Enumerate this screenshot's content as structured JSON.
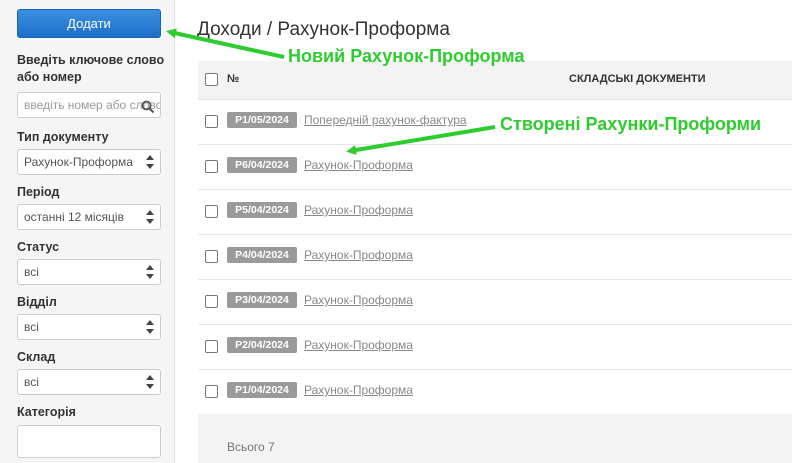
{
  "sidebar": {
    "add_button": "Додати",
    "keyword_label": "Введіть ключове слово або номер",
    "search_placeholder": "введіть номер або слово",
    "doc_type_label": "Тип документу",
    "doc_type_value": "Рахунок-Проформа",
    "period_label": "Період",
    "period_value": "останні 12 місяців",
    "status_label": "Статус",
    "status_value": "всі",
    "department_label": "Відділ",
    "department_value": "всі",
    "warehouse_label": "Склад",
    "warehouse_value": "всі",
    "category_label": "Категорія",
    "category_value": ""
  },
  "page_title": "Доходи / Рахунок-Проформа",
  "table": {
    "col_number": "№",
    "col_docs": "СКЛАДСЬКІ ДОКУМЕНТИ",
    "rows": [
      {
        "number": "P1/05/2024",
        "type": "Попередній рахунок-фактура"
      },
      {
        "number": "P6/04/2024",
        "type": "Рахунок-Проформа"
      },
      {
        "number": "P5/04/2024",
        "type": "Рахунок-Проформа"
      },
      {
        "number": "P4/04/2024",
        "type": "Рахунок-Проформа"
      },
      {
        "number": "P3/04/2024",
        "type": "Рахунок-Проформа"
      },
      {
        "number": "P2/04/2024",
        "type": "Рахунок-Проформа"
      },
      {
        "number": "P1/04/2024",
        "type": "Рахунок-Проформа"
      }
    ],
    "total": "Всього 7"
  },
  "annotations": {
    "new_proforma": "Новий Рахунок-Проформа",
    "created_proformas": "Створені Рахунки-Проформи",
    "color": "#2ecc2e"
  }
}
